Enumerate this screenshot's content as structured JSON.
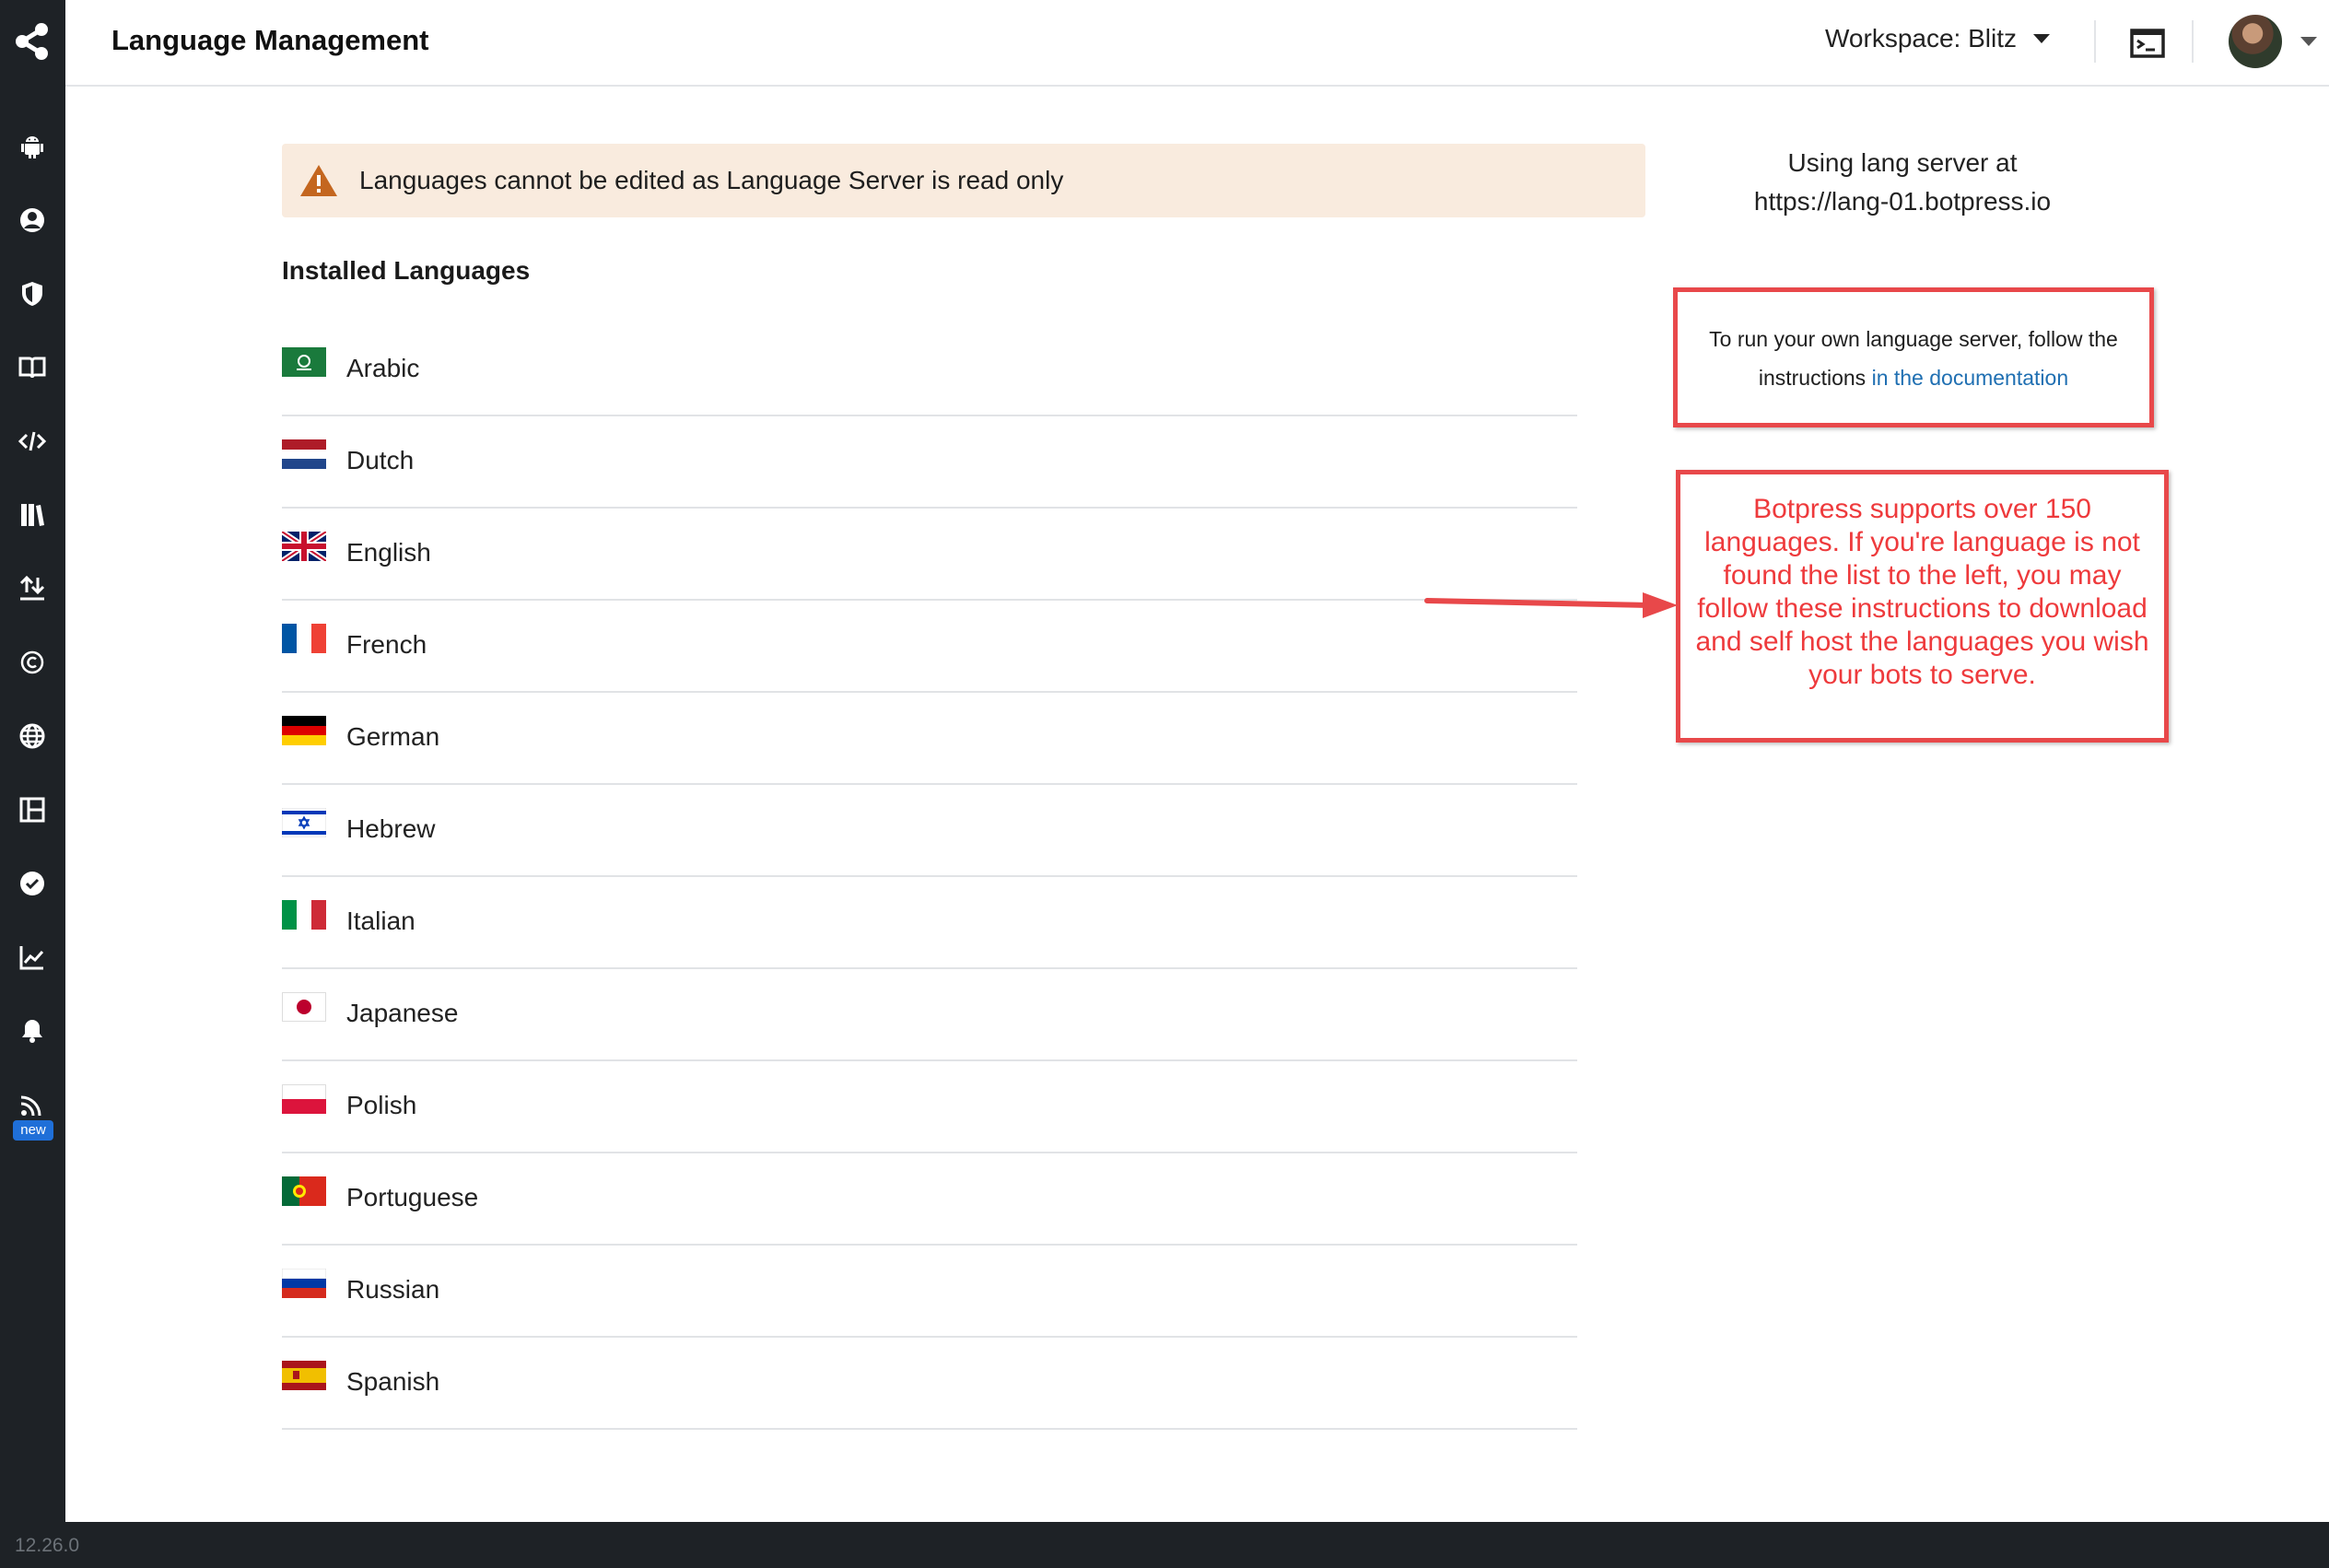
{
  "header": {
    "title": "Language Management",
    "workspace_label": "Workspace: Blitz"
  },
  "sidebar": {
    "new_badge": "new",
    "items": [
      {
        "icon": "android-icon"
      },
      {
        "icon": "user-circle-icon"
      },
      {
        "icon": "shield-icon"
      },
      {
        "icon": "book-icon"
      },
      {
        "icon": "code-icon"
      },
      {
        "icon": "library-icon"
      },
      {
        "icon": "import-export-icon"
      },
      {
        "icon": "copyright-icon"
      },
      {
        "icon": "globe-icon"
      },
      {
        "icon": "layout-panel-icon"
      },
      {
        "icon": "check-badge-icon"
      },
      {
        "icon": "trend-chart-icon"
      },
      {
        "icon": "bell-icon"
      },
      {
        "icon": "rss-feed-icon"
      }
    ]
  },
  "warning": {
    "text": "Languages cannot be edited as Language Server is read only"
  },
  "installed": {
    "title": "Installed Languages",
    "languages": [
      {
        "name": "Arabic",
        "flag": "sa"
      },
      {
        "name": "Dutch",
        "flag": "nl"
      },
      {
        "name": "English",
        "flag": "gb"
      },
      {
        "name": "French",
        "flag": "fr"
      },
      {
        "name": "German",
        "flag": "de"
      },
      {
        "name": "Hebrew",
        "flag": "il"
      },
      {
        "name": "Italian",
        "flag": "it"
      },
      {
        "name": "Japanese",
        "flag": "jp"
      },
      {
        "name": "Polish",
        "flag": "pl"
      },
      {
        "name": "Portuguese",
        "flag": "pt"
      },
      {
        "name": "Russian",
        "flag": "ru"
      },
      {
        "name": "Spanish",
        "flag": "es"
      }
    ]
  },
  "server": {
    "line1": "Using lang server at",
    "line2": "https://lang-01.botpress.io"
  },
  "docs": {
    "text": "To run your own language server, follow the instructions ",
    "link_text": "in the documentation"
  },
  "annotation": {
    "text": "Botpress supports over 150 languages. If you're language is not found the list to the left, you may follow these instructions to download and self host the languages you wish your bots to serve."
  },
  "footer": {
    "version": "12.26.0"
  },
  "colors": {
    "sidebar_bg": "#1e2226",
    "warning_bg": "#f9ebde",
    "annotation_red": "#e8484a",
    "link_blue": "#1f6fb2"
  }
}
